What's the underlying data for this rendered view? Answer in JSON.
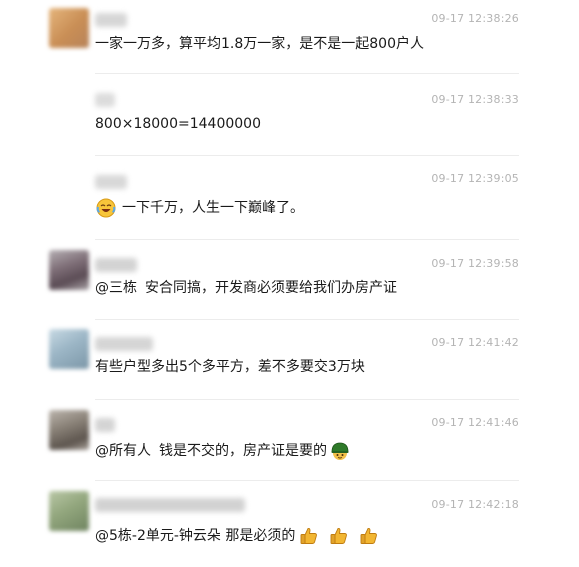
{
  "messages": [
    {
      "id": "m1",
      "timestamp": "09-17 12:38:26",
      "text": "一家一万多，算平均1.8万一家，是不是一起800户人",
      "avatar_color": "#d9a56b"
    },
    {
      "id": "m2",
      "timestamp": "09-17 12:38:33",
      "text": "800×18000=14400000"
    },
    {
      "id": "m3",
      "timestamp": "09-17 12:39:05",
      "text": "一下千万，人生一下巅峰了。",
      "emoji": "crying-laughing-emoji-icon"
    },
    {
      "id": "m4",
      "timestamp": "09-17 12:39:58",
      "text_part1": "@三栋",
      "text_part2": "安合同搞，开发商必须要给我们办房产证",
      "avatar_color": "#8b7d84"
    },
    {
      "id": "m5",
      "timestamp": "09-17 12:41:42",
      "text": "有些户型多出5个多平方，差不多要交3万块",
      "avatar_color": "#9cb6c6"
    },
    {
      "id": "m6",
      "timestamp": "09-17 12:41:46",
      "text_part1": "@所有人",
      "text_part2": "钱是不交的，房产证是要的",
      "emoji": "helmet-emoji-icon",
      "avatar_color": "#8a8278"
    },
    {
      "id": "m7",
      "timestamp": "09-17 12:42:18",
      "text": "@5栋-2单元-钟云朵 那是必须的",
      "emoji": "thumbs-up-icon",
      "avatar_color": "#93a77e"
    }
  ],
  "colors": {
    "timestamp": "#b4b4b4",
    "divider": "#ececec",
    "text": "#1a1a1a"
  }
}
